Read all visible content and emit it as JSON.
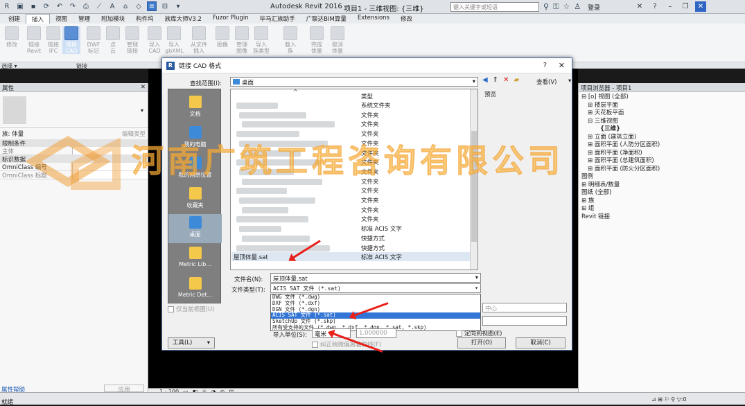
{
  "app": {
    "title": "Autodesk Revit 2016 -",
    "document": "项目1 - 三维视图: {三维}",
    "search_placeholder": "键入关键字或短语",
    "login": "登录"
  },
  "tabs": [
    "创建",
    "插入",
    "视图",
    "管理",
    "附加模块",
    "构件坞",
    "族库大师V3.2",
    "Fuzor Plugin",
    "毕马汇族助手",
    "广联达BIM算量",
    "Extensions",
    "修改"
  ],
  "active_tab": "插入",
  "ribbon": {
    "buttons": [
      {
        "label": "修改",
        "on": false
      },
      {
        "label": "链接\nRevit",
        "on": false
      },
      {
        "label": "链接\nIFC",
        "on": false
      },
      {
        "label": "链接\nCAD",
        "on": true
      },
      {
        "label": "DWF\n标记",
        "on": false
      },
      {
        "label": "点\n云",
        "on": false
      },
      {
        "label": "管理\n链接",
        "on": false
      },
      {
        "label": "导入\nCAD",
        "on": false
      },
      {
        "label": "导入\ngbXML",
        "on": false
      },
      {
        "label": "从文件\n插入",
        "on": false
      },
      {
        "label": "图像",
        "on": false
      },
      {
        "label": "管理\n图像",
        "on": false
      },
      {
        "label": "导入\n族类型",
        "on": false
      },
      {
        "label": "载入\n族",
        "on": false
      },
      {
        "label": "完成\n体量",
        "on": false
      },
      {
        "label": "取消\n体量",
        "on": false
      }
    ],
    "footer_select": "选择 ▾",
    "footer_group": "链接"
  },
  "properties": {
    "title": "属性",
    "family": "族: 体量",
    "edit_type": "编辑类型",
    "section_constraints": "限制条件",
    "host_label": "主体",
    "section_identity": "标识数据",
    "omniclass_number": "OmniClass 编号",
    "omniclass_title": "OmniClass 标题",
    "help_link": "属性帮助",
    "apply": "应用"
  },
  "browser": {
    "title": "项目浏览器 - 项目1",
    "items": [
      {
        "text": "⊟ [o] 视图 (全部)",
        "indent": 0
      },
      {
        "text": "⊞ 楼层平面",
        "indent": 1
      },
      {
        "text": "⊞ 天花板平面",
        "indent": 1
      },
      {
        "text": "⊟ 三维视图",
        "indent": 1
      },
      {
        "text": "{三维}",
        "indent": 3,
        "bold": true
      },
      {
        "text": "⊞ 立面 (建筑立面)",
        "indent": 1
      },
      {
        "text": "⊞ 面积平面 (人防分区面积)",
        "indent": 1
      },
      {
        "text": "⊞ 面积平面 (净面积)",
        "indent": 1
      },
      {
        "text": "⊞ 面积平面 (总建筑面积)",
        "indent": 1
      },
      {
        "text": "⊞ 面积平面 (防火分区面积)",
        "indent": 1
      },
      {
        "text": "图例",
        "indent": 0
      },
      {
        "text": "⊞ 明细表/数量",
        "indent": 0
      },
      {
        "text": "图纸 (全部)",
        "indent": 0
      },
      {
        "text": "⊞ 族",
        "indent": 0
      },
      {
        "text": "⊞ 组",
        "indent": 0
      },
      {
        "text": "Revit 链接",
        "indent": 0
      }
    ]
  },
  "dialog": {
    "title": "链接 CAD 格式",
    "look_in_label": "查找范围(I):",
    "look_in_value": "桌面",
    "view_label": "查看(V)",
    "preview_label": "预览",
    "places": [
      "文档",
      "我的电脑",
      "我的网络位置",
      "收藏夹",
      "桌面",
      "Metric Lib...",
      "Metric Det..."
    ],
    "column_type": "类型",
    "file_types": [
      "系统文件夹",
      "文件夹",
      "文件夹",
      "文件夹",
      "文件夹",
      "文件夹",
      "文件夹",
      "文件夹",
      "文件夹",
      "文件夹",
      "文件夹",
      "文件夹",
      "文件夹",
      "标准 ACIS 文字",
      "快捷方式",
      "快捷方式",
      "标准 ACIS 文字"
    ],
    "selected_file": "屋顶体量.sat",
    "filename_label": "文件名(N):",
    "filename_value": "屋顶体量.sat",
    "filetype_label": "文件类型(T):",
    "filetype_value": "ACIS SAT 文件 (*.sat)",
    "filetype_options": [
      "DWG 文件 (*.dwg)",
      "DXF 文件 (*.dxf)",
      "DGN 文件 (*.dgn)",
      "ACIS SAT 文件 (*.sat)",
      "SketchUp 文件 (*.skp)",
      "所有受支持的文件 (*.dwg, *.dxf, *.dgn, *.sat, *.skp)"
    ],
    "filetype_selected_index": 3,
    "current_view_only": "仅当前视图(U)",
    "positioning_value": "中心",
    "import_units_label": "导入单位(S):",
    "import_units_value": "毫米",
    "scale_value": "1.000000",
    "correct_lines": "纠正稍微偏离轴的线(F)",
    "orient_view": "定向到视图(E)",
    "tools_button": "工具(L)",
    "open_button": "打开(O)",
    "cancel_button": "取消(C)"
  },
  "view_control": {
    "scale": "1 : 100"
  },
  "status": {
    "text": "就绪"
  },
  "watermark": {
    "text": "河南广筑工程咨询有限公司"
  },
  "colors": {
    "accent": "#3375d6",
    "watermark": "#ffc446",
    "arrow": "#e8201a"
  }
}
